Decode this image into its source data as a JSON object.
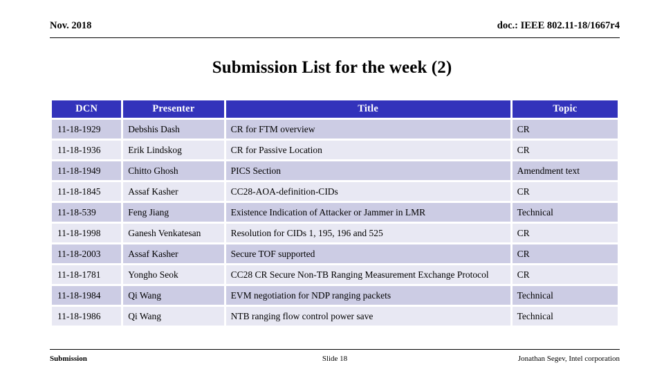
{
  "header": {
    "date": "Nov. 2018",
    "doc": "doc.: IEEE 802.11-18/1667r4"
  },
  "title": "Submission List for the week (2)",
  "table": {
    "columns": [
      "DCN",
      "Presenter",
      "Title",
      "Topic"
    ],
    "rows": [
      {
        "dcn": "11-18-1929",
        "presenter": "Debshis Dash",
        "title": "CR for FTM overview",
        "topic": "CR"
      },
      {
        "dcn": "11-18-1936",
        "presenter": "Erik Lindskog",
        "title": "CR for Passive Location",
        "topic": "CR"
      },
      {
        "dcn": "11-18-1949",
        "presenter": "Chitto Ghosh",
        "title": "PICS Section",
        "topic": "Amendment text"
      },
      {
        "dcn": "11-18-1845",
        "presenter": "Assaf Kasher",
        "title": "CC28-AOA-definition-CIDs",
        "topic": "CR"
      },
      {
        "dcn": "11-18-539",
        "presenter": "Feng Jiang",
        "title": "Existence Indication of Attacker or Jammer in LMR",
        "topic": "Technical"
      },
      {
        "dcn": "11-18-1998",
        "presenter": "Ganesh Venkatesan",
        "title": "Resolution for CIDs 1, 195, 196 and 525",
        "topic": "CR"
      },
      {
        "dcn": "11-18-2003",
        "presenter": "Assaf Kasher",
        "title": "Secure TOF supported",
        "topic": "CR"
      },
      {
        "dcn": "11-18-1781",
        "presenter": "Yongho Seok",
        "title": "CC28 CR Secure Non-TB Ranging Measurement Exchange Protocol",
        "topic": "CR"
      },
      {
        "dcn": "11-18-1984",
        "presenter": "Qi Wang",
        "title": "EVM negotiation for NDP ranging packets",
        "topic": "Technical"
      },
      {
        "dcn": "11-18-1986",
        "presenter": "Qi Wang",
        "title": "NTB ranging flow control power save",
        "topic": "Technical"
      }
    ]
  },
  "footer": {
    "left": "Submission",
    "center": "Slide 18",
    "right": "Jonathan Segev, Intel corporation"
  },
  "colors": {
    "header_blue": "#3333bb",
    "row_odd": "#ccccE4",
    "row_even": "#e8e8f3"
  }
}
